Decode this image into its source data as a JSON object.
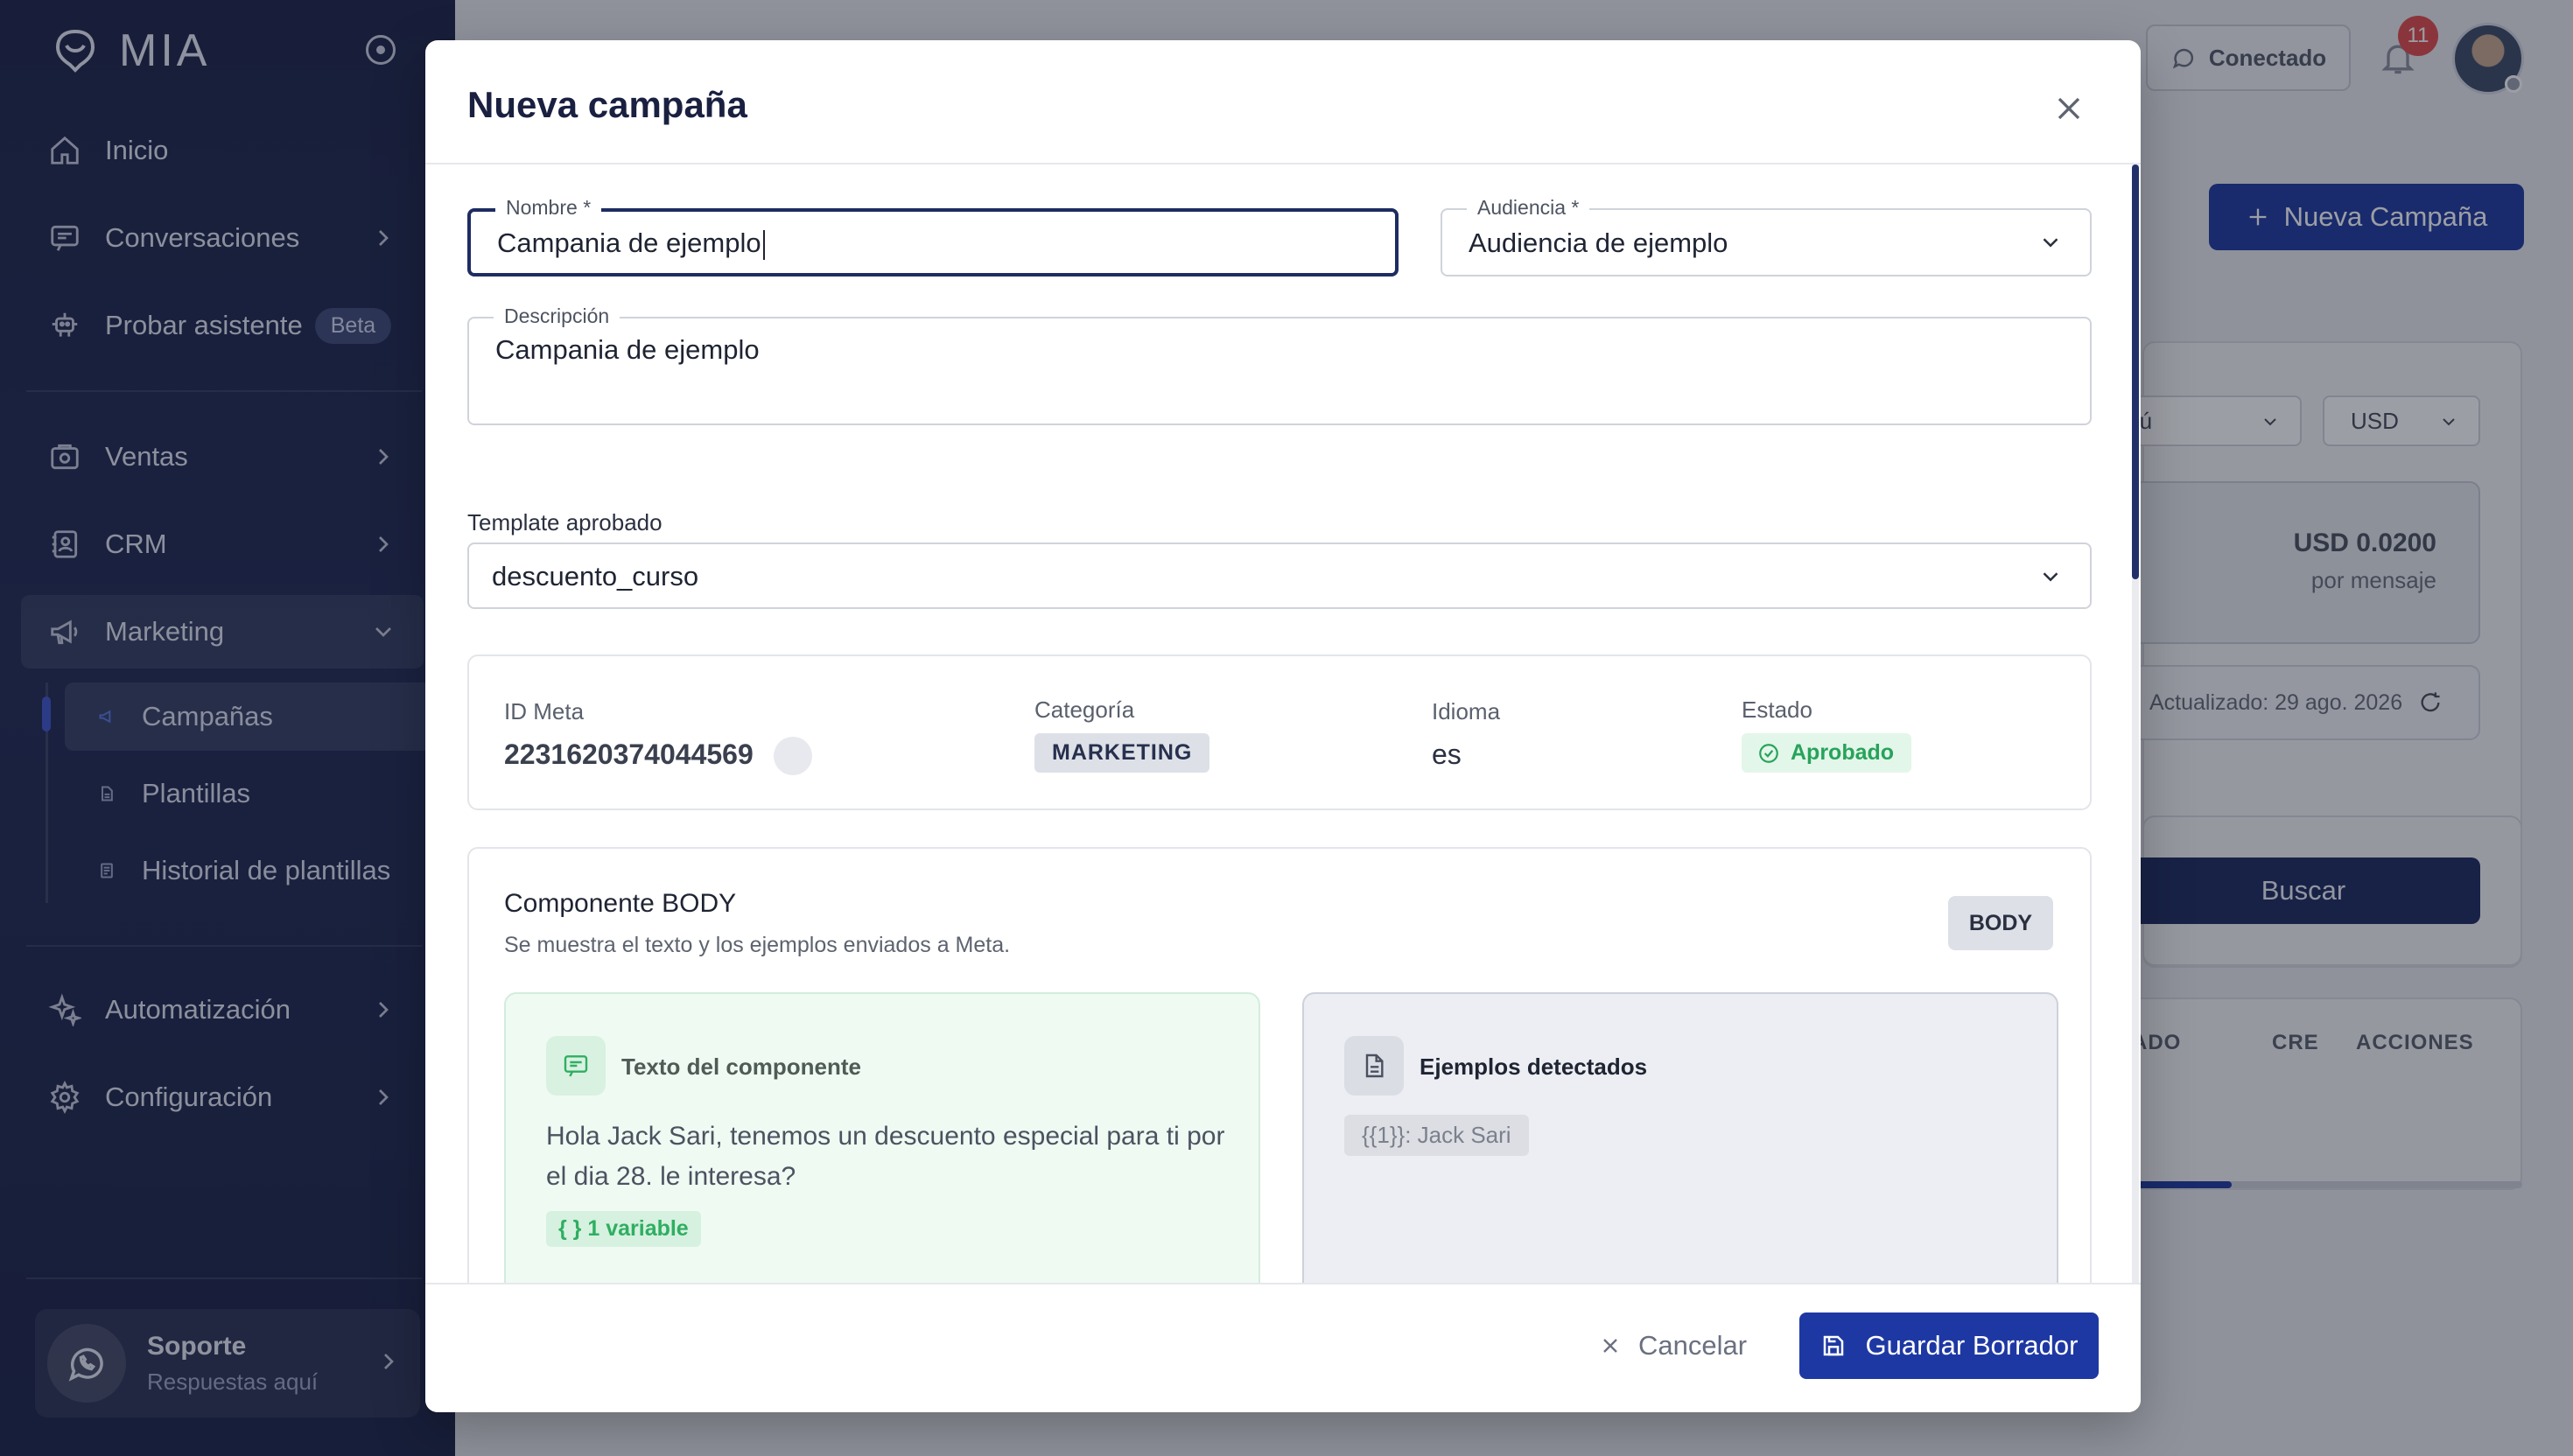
{
  "app": {
    "logo_text": "MIA"
  },
  "sidebar": {
    "items": [
      {
        "label": "Inicio",
        "icon": "home-icon"
      },
      {
        "label": "Conversaciones",
        "icon": "chat-icon"
      },
      {
        "label": "Probar asistente",
        "icon": "robot-icon",
        "badge": "Beta"
      },
      {
        "label": "Ventas",
        "icon": "sales-icon"
      },
      {
        "label": "CRM",
        "icon": "contacts-icon"
      },
      {
        "label": "Marketing",
        "icon": "megaphone-icon",
        "expanded": true
      }
    ],
    "marketing_sub": [
      {
        "label": "Campañas",
        "icon": "megaphone-icon",
        "active": true
      },
      {
        "label": "Plantillas",
        "icon": "document-icon"
      },
      {
        "label": "Historial de plantillas",
        "icon": "history-icon"
      }
    ],
    "items_bottom": [
      {
        "label": "Automatización",
        "icon": "sparkles-icon"
      },
      {
        "label": "Configuración",
        "icon": "gear-icon"
      }
    ],
    "support": {
      "title": "Soporte",
      "subtitle": "Respuestas aquí"
    }
  },
  "topbar": {
    "connection_label": "Conectado",
    "notification_count": "11"
  },
  "background_page": {
    "new_campaign_label": "Nueva Campaña",
    "country_select": "rú",
    "currency_select": "USD",
    "price": "USD 0.0200",
    "price_unit": "por mensaje",
    "updated_text": "Actualizado: 29 ago. 2026",
    "search_label": "Buscar",
    "table_headers": [
      "ADO",
      "CRE",
      "ACCIONES"
    ]
  },
  "modal": {
    "title": "Nueva campaña",
    "nombre": {
      "label": "Nombre *",
      "value": "Campania de ejemplo"
    },
    "audiencia": {
      "label": "Audiencia *",
      "value": "Audiencia de ejemplo"
    },
    "descripcion": {
      "label": "Descripción",
      "value": "Campania de ejemplo"
    },
    "template": {
      "label": "Template aprobado",
      "value": "descuento_curso"
    },
    "meta": {
      "id_label": "ID Meta",
      "id_value": "2231620374044569",
      "category_label": "Categoría",
      "category_value": "MARKETING",
      "language_label": "Idioma",
      "language_value": "es",
      "status_label": "Estado",
      "status_value": "Aprobado"
    },
    "body_component": {
      "title": "Componente BODY",
      "subtitle": "Se muestra el texto y los ejemplos enviados a Meta.",
      "tag": "BODY",
      "text_panel_title": "Texto del componente",
      "text": "Hola Jack Sari, tenemos un descuento especial para ti por el dia 28. le interesa?",
      "variable_count": "1 variable",
      "examples_panel_title": "Ejemplos detectados",
      "example": "{{1}}: Jack Sari"
    },
    "footer": {
      "cancel_label": "Cancelar",
      "save_label": "Guardar Borrador"
    }
  },
  "colors": {
    "sidebar_bg": "#1f2a52",
    "primary": "#1e38a3",
    "success": "#27a35a",
    "danger": "#e14b4b"
  }
}
